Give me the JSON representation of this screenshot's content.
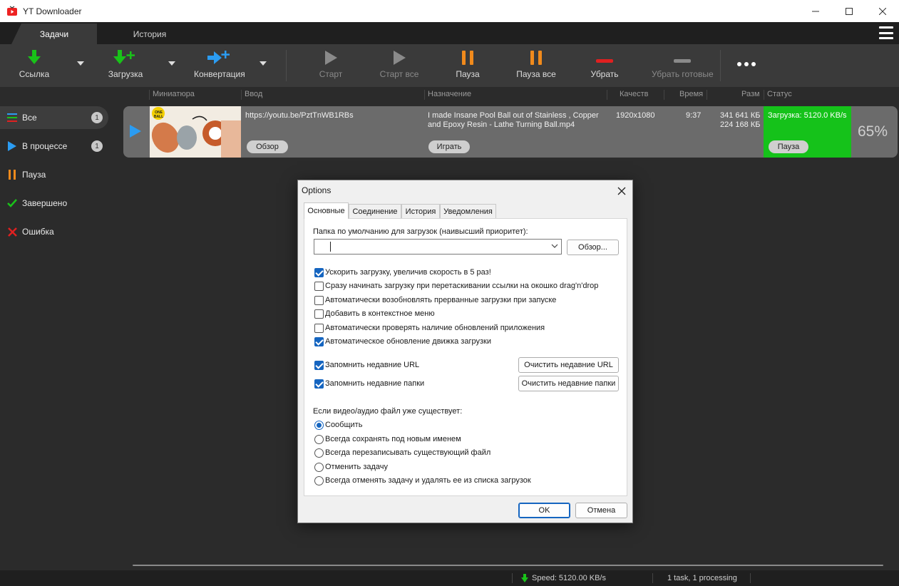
{
  "app": {
    "title": "YT Downloader",
    "icon": "youtube-tv-icon"
  },
  "tabs": [
    {
      "label": "Задачи",
      "active": true
    },
    {
      "label": "История",
      "active": false
    }
  ],
  "toolbar": {
    "link": "Ссылка",
    "download": "Загрузка",
    "convert": "Конвертация",
    "start": "Старт",
    "start_all": "Старт все",
    "pause": "Пауза",
    "pause_all": "Пауза все",
    "remove": "Убрать",
    "remove_done": "Убрать готовые"
  },
  "columns": [
    "Миниатюра",
    "Ввод",
    "Назначение",
    "Качеств",
    "Время",
    "Разм",
    "Статус"
  ],
  "sidebar": {
    "items": [
      {
        "label": "Все",
        "count": "1",
        "icon": "list-icon"
      },
      {
        "label": "В процессе",
        "count": "1",
        "icon": "play-icon"
      },
      {
        "label": "Пауза",
        "icon": "pause-icon"
      },
      {
        "label": "Завершено",
        "icon": "check-icon"
      },
      {
        "label": "Ошибка",
        "icon": "error-x-icon"
      }
    ]
  },
  "task": {
    "url": "https://youtu.be/PztTnWB1RBs",
    "destination": "I made Insane Pool Ball out of Stainless , Copper and Epoxy Resin - Lathe Turning Ball.mp4",
    "quality": "1920x1080",
    "time": "9:37",
    "size_total": "341 641 КБ",
    "size_done": "224 168 КБ",
    "status": "Загрузка: 5120.0 KB/s",
    "percent": "65%",
    "browse": "Обзор",
    "play": "Играть",
    "pause": "Пауза",
    "thumb_badge": "ONE BALL",
    "progress_fraction": 0.65
  },
  "statusbar": {
    "speed": "Speed: 5120.00 KB/s",
    "tasks": "1 task, 1 processing"
  },
  "dialog": {
    "title": "Options",
    "tabs": [
      "Основные",
      "Соединение",
      "История",
      "Уведомления"
    ],
    "folder_label": "Папка по умолчанию для загрузок (наивысший приоритет):",
    "folder_value": "",
    "browse": "Обзор...",
    "checkboxes": [
      {
        "label": "Ускорить загрузку, увеличив скорость в 5 раз!",
        "checked": true
      },
      {
        "label": "Сразу начинать загрузку при перетаскивании ссылки на окошко drag'n'drop",
        "checked": false
      },
      {
        "label": "Автоматически возобновлять прерванные загрузки при запуске",
        "checked": false
      },
      {
        "label": "Добавить в контекстное меню",
        "checked": false
      },
      {
        "label": "Автоматически проверять наличие обновлений приложения",
        "checked": false
      },
      {
        "label": "Автоматическое обновление движка загрузки",
        "checked": true
      }
    ],
    "remember_urls": "Запомнить недавние URL",
    "remember_folders": "Запомнить недавние папки",
    "clear_urls": "Очистить недавние URL",
    "clear_folders": "Очистить недавние папки",
    "exists_label": "Если видео/аудио файл уже существует:",
    "radios": [
      {
        "label": "Сообщить",
        "checked": true
      },
      {
        "label": "Всегда сохранять под новым именем",
        "checked": false
      },
      {
        "label": "Всегда перезаписывать существующий файл",
        "checked": false
      },
      {
        "label": "Отменить задачу",
        "checked": false
      },
      {
        "label": "Всегда отменять задачу и удалять ее из списка загрузок",
        "checked": false
      }
    ],
    "ok": "OK",
    "cancel": "Отмена"
  },
  "colors": {
    "accent_green": "#15c21a",
    "accent_blue": "#2b9cf2",
    "accent_orange": "#f08a1c",
    "accent_red": "#e02020"
  }
}
